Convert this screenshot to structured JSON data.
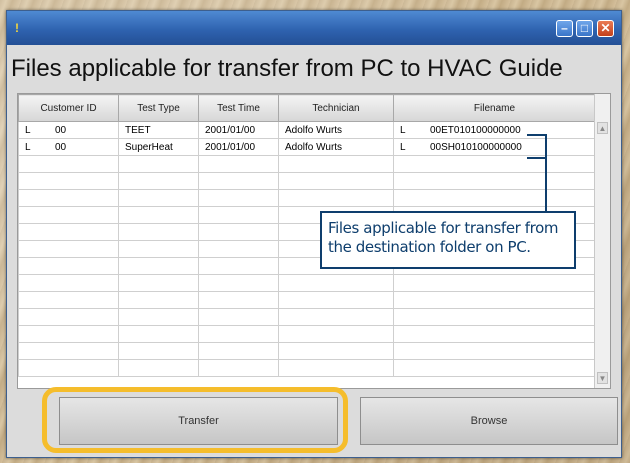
{
  "window": {
    "title_icon": "!",
    "heading": "Files applicable for transfer from PC to HVAC Guide"
  },
  "titlebar_buttons": {
    "minimize": "–",
    "maximize": "□",
    "close": "✕"
  },
  "table": {
    "columns": [
      "Customer ID",
      "Test Type",
      "Test Time",
      "Technician",
      "Filename"
    ],
    "rows": [
      {
        "customer_prefix": "L",
        "customer_id": "00",
        "test_type": "TEET",
        "test_time": "2001/01/00",
        "technician": "Adolfo Wurts",
        "file_prefix": "L",
        "filename": "00ET010100000000"
      },
      {
        "customer_prefix": "L",
        "customer_id": "00",
        "test_type": "SuperHeat",
        "test_time": "2001/01/00",
        "technician": "Adolfo Wurts",
        "file_prefix": "L",
        "filename": "00SH010100000000"
      }
    ],
    "empty_row_count": 13
  },
  "callout": {
    "text": "Files applicable for transfer from the destination folder on PC."
  },
  "buttons": {
    "transfer": "Transfer",
    "browse": "Browse"
  },
  "colors": {
    "titlebar": "#2f63b0",
    "callout_border": "#0e3e6d",
    "highlight": "#f5bd2c"
  },
  "icons": {
    "scroll_up": "scroll-up-arrow-icon",
    "scroll_down": "scroll-down-arrow-icon"
  }
}
